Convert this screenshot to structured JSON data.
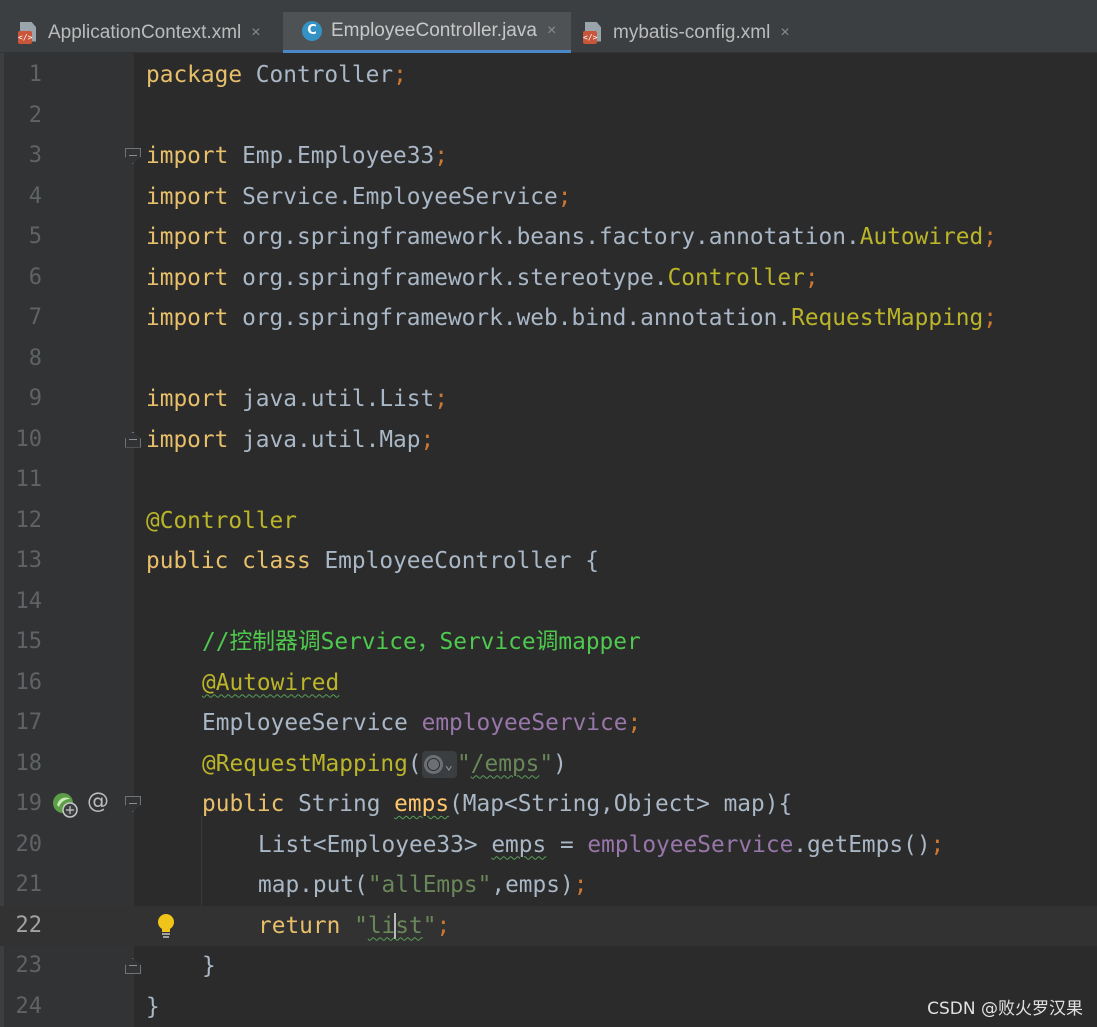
{
  "tabs": [
    {
      "label": "ApplicationContext.xml",
      "icon": "xml-file-icon",
      "active": false,
      "close": "×"
    },
    {
      "label": "EmployeeController.java",
      "icon": "java-class-icon",
      "active": true,
      "close": "×"
    },
    {
      "label": "mybatis-config.xml",
      "icon": "xml-file-icon",
      "active": false,
      "close": "×"
    }
  ],
  "editor": {
    "current_line": 22,
    "lines": [
      {
        "n": "1"
      },
      {
        "n": "2"
      },
      {
        "n": "3"
      },
      {
        "n": "4"
      },
      {
        "n": "5"
      },
      {
        "n": "6"
      },
      {
        "n": "7"
      },
      {
        "n": "8"
      },
      {
        "n": "9"
      },
      {
        "n": "10"
      },
      {
        "n": "11"
      },
      {
        "n": "12"
      },
      {
        "n": "13"
      },
      {
        "n": "14"
      },
      {
        "n": "15"
      },
      {
        "n": "16"
      },
      {
        "n": "17"
      },
      {
        "n": "18"
      },
      {
        "n": "19"
      },
      {
        "n": "20"
      },
      {
        "n": "21"
      },
      {
        "n": "22"
      },
      {
        "n": "23"
      },
      {
        "n": "24"
      }
    ],
    "code": {
      "l1": {
        "kw": "package",
        "pkg": " Controller",
        "end": ";"
      },
      "l3": {
        "kw": "import",
        "pkg": " Emp.Employee33",
        "end": ";"
      },
      "l4": {
        "kw": "import",
        "pkg": " Service.EmployeeService",
        "end": ";"
      },
      "l5": {
        "kw": "import",
        "pkg": " org.springframework.beans.factory.annotation.",
        "cls": "Autowired",
        "end": ";"
      },
      "l6": {
        "kw": "import",
        "pkg": " org.springframework.stereotype.",
        "cls": "Controller",
        "end": ";"
      },
      "l7": {
        "kw": "import",
        "pkg": " org.springframework.web.bind.annotation.",
        "cls": "RequestMapping",
        "end": ";"
      },
      "l9": {
        "kw": "import",
        "pkg": " java.util.List",
        "end": ";"
      },
      "l10": {
        "kw": "import",
        "pkg": " java.util.Map",
        "end": ";"
      },
      "l12": {
        "ann": "@Controller"
      },
      "l13": {
        "kw1": "public",
        "kw2": "class",
        "name": " EmployeeController {"
      },
      "l15": {
        "comment": "//控制器调Service，Service调mapper"
      },
      "l16": {
        "ann": "@Autowired"
      },
      "l17": {
        "type": "EmployeeService ",
        "field": "employeeService",
        "end": ";"
      },
      "l18": {
        "ann": "@RequestMapping",
        "open": "(",
        "q1": "\"",
        "path": "/emps",
        "q2": "\"",
        "close": ")"
      },
      "l19": {
        "kw": "public",
        "type": " String ",
        "fn": "emps",
        "params": "(Map<String,Object> map){"
      },
      "l20": {
        "type": "List<Employee33> ",
        "var": "emps",
        "eq": " = ",
        "field": "employeeService",
        "call": ".getEmps()",
        "end": ";"
      },
      "l21": {
        "pre": "map.put(",
        "str": "\"allEmps\"",
        "mid": ",emps)",
        "end": ";"
      },
      "l22": {
        "kw": "return",
        "q1": " \"",
        "s1": "li",
        "s2": "st",
        "q2": "\"",
        "end": ";"
      },
      "l23": {
        "text": "}"
      },
      "l24": {
        "text": "}"
      }
    }
  },
  "gutter": {
    "at_symbol": "@"
  },
  "watermark": "CSDN @败火罗汉果"
}
